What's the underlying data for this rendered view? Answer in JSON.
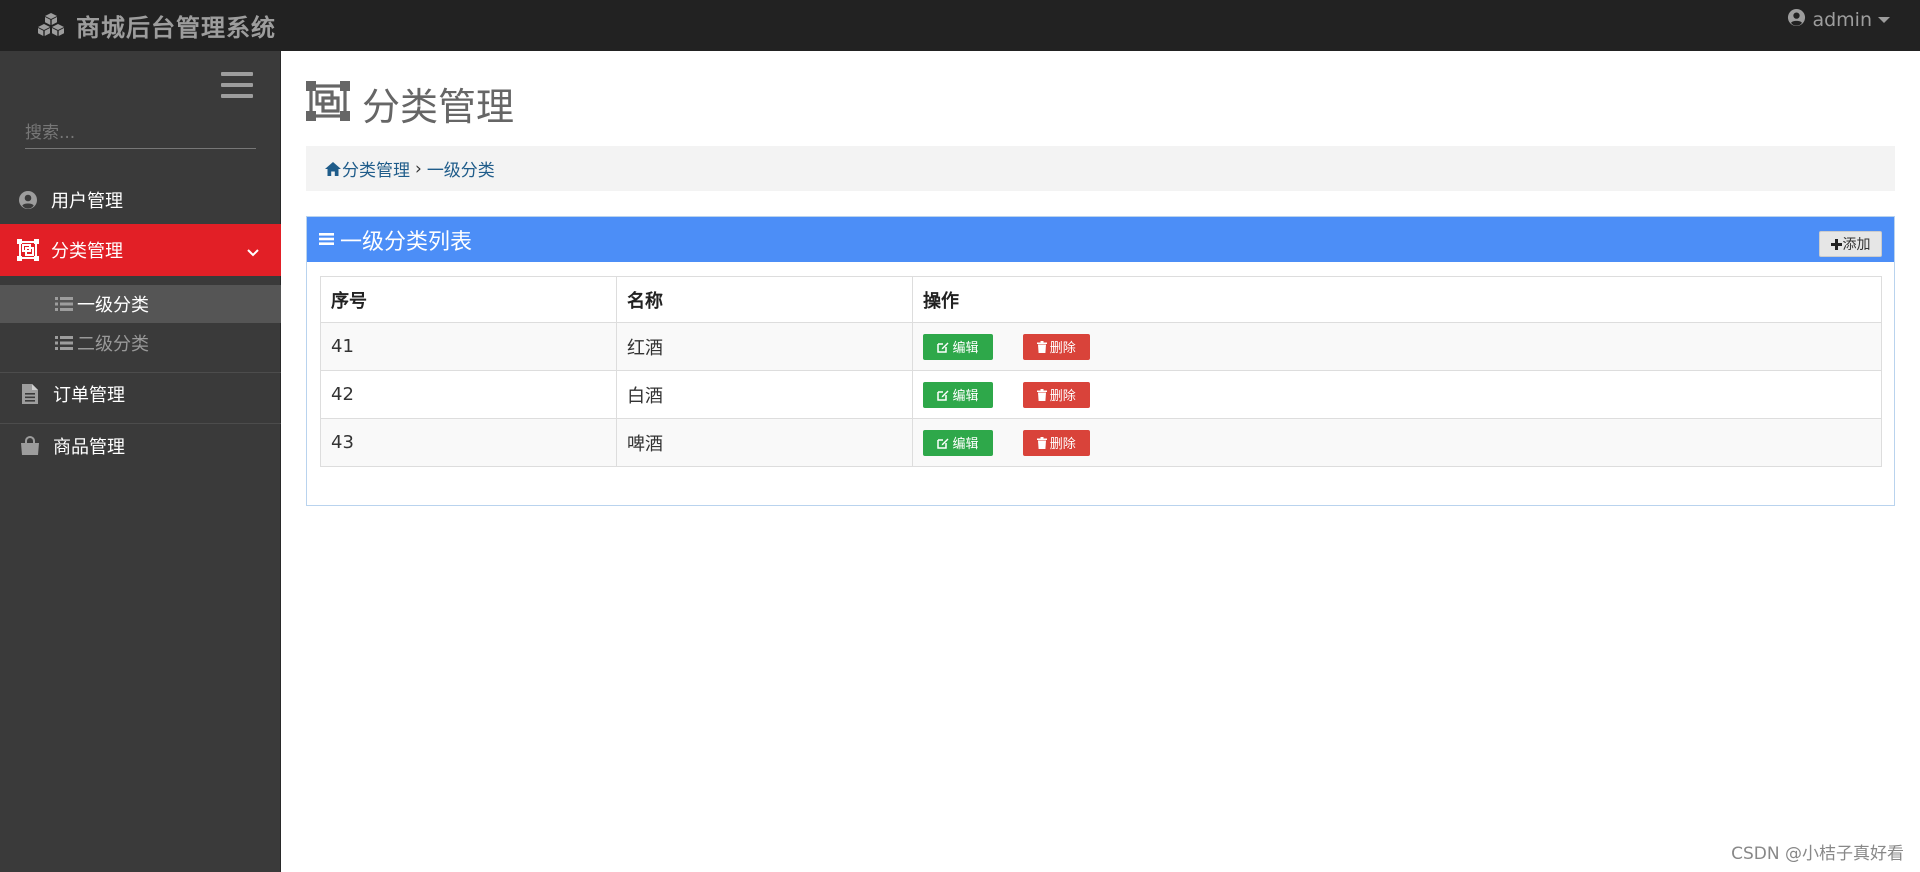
{
  "app": {
    "title": "商城后台管理系统",
    "user": "admin"
  },
  "sidebar": {
    "search_placeholder": "搜索...",
    "items": [
      {
        "label": "用户管理",
        "icon": "user-circle-icon"
      },
      {
        "label": "分类管理",
        "icon": "category-icon",
        "active": true,
        "children": [
          {
            "label": "一级分类",
            "icon": "list-icon",
            "active": true
          },
          {
            "label": "二级分类",
            "icon": "list-icon"
          }
        ]
      },
      {
        "label": "订单管理",
        "icon": "document-icon"
      },
      {
        "label": "商品管理",
        "icon": "shopping-bag-icon"
      }
    ]
  },
  "page": {
    "title": "分类管理",
    "breadcrumb": [
      "分类管理",
      "一级分类"
    ]
  },
  "panel": {
    "title": "一级分类列表",
    "add_label": "添加",
    "columns": [
      "序号",
      "名称",
      "操作"
    ],
    "edit_label": "编辑",
    "delete_label": "删除",
    "rows": [
      {
        "id": "41",
        "name": "红酒"
      },
      {
        "id": "42",
        "name": "白酒"
      },
      {
        "id": "43",
        "name": "啤酒"
      }
    ]
  },
  "watermark": "CSDN @小桔子真好看",
  "colors": {
    "topbar": "#222222",
    "sidebar": "#3a3a3a",
    "active_nav": "#e21f26",
    "panel_heading": "#4c8ef7",
    "edit_button": "#2ea84a",
    "delete_button": "#d9433a"
  }
}
